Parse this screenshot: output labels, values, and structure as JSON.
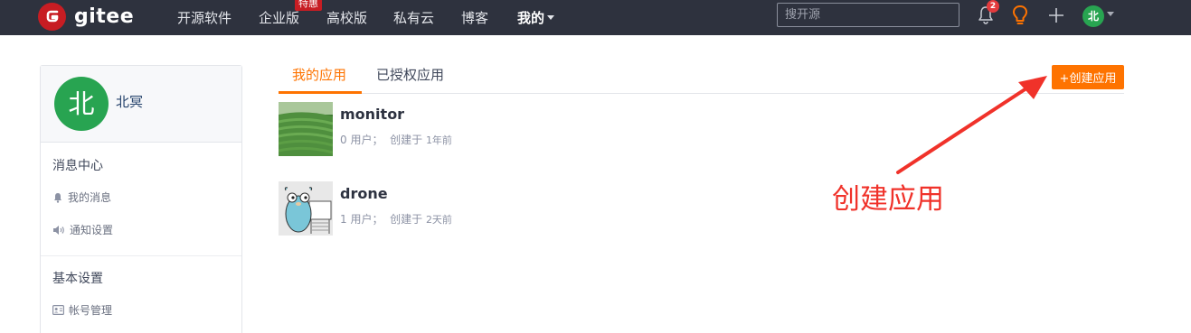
{
  "header": {
    "logo_text": "gitee",
    "nav": [
      "开源软件",
      "企业版",
      "高校版",
      "私有云",
      "博客"
    ],
    "nav_tag": "特惠",
    "nav_my": "我的",
    "search_placeholder": "搜开源",
    "notification_count": "2",
    "avatar_char": "北",
    "colors": {
      "bar": "#2e323e",
      "brand": "#c71d23"
    },
    "icons": [
      "gitee-logo-icon",
      "bell-icon",
      "bulb-icon",
      "plus-icon",
      "chevron-down-icon"
    ]
  },
  "sidebar": {
    "avatar_char": "北",
    "user_name": "北冥",
    "sections": [
      {
        "title": "消息中心",
        "items": [
          {
            "label": "我的消息",
            "icon": "bell-icon"
          },
          {
            "label": "通知设置",
            "icon": "volume-icon"
          }
        ]
      },
      {
        "title": "基本设置",
        "items": [
          {
            "label": "帐号管理",
            "icon": "id-card-icon"
          }
        ]
      }
    ]
  },
  "main": {
    "tabs": [
      {
        "label": "我的应用",
        "active": true
      },
      {
        "label": "已授权应用",
        "active": false
      }
    ],
    "create_button": "+创建应用",
    "apps": [
      {
        "name": "monitor",
        "users": "0 用户；",
        "created_label": "创建于",
        "created_time": "1年前",
        "thumb": "tea-field-image"
      },
      {
        "name": "drone",
        "users": "1 用户；",
        "created_label": "创建于",
        "created_time": "2天前",
        "thumb": "gopher-image"
      }
    ],
    "accent_color": "#fe7300"
  },
  "annotation": {
    "text": "创建应用",
    "color": "#f0322a"
  }
}
